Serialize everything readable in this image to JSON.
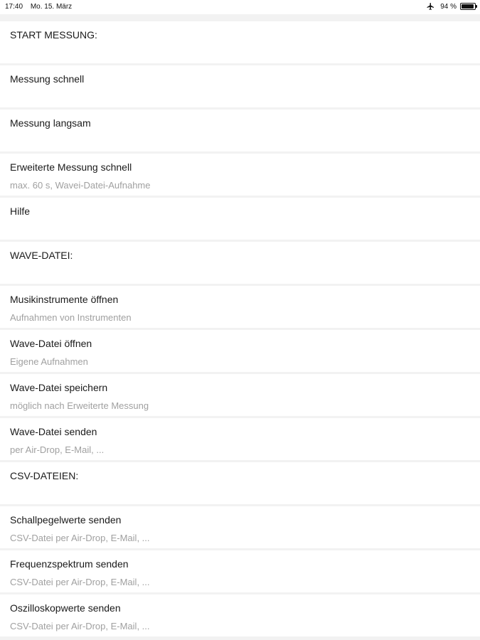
{
  "status_bar": {
    "time": "17:40",
    "date": "Mo. 15. März",
    "battery": "94 %",
    "battery_level": 0.94,
    "icons": [
      "airplane-icon",
      "battery-icon"
    ]
  },
  "rows": [
    {
      "title": "START MESSUNG:",
      "subtitle": ""
    },
    {
      "title": "Messung schnell",
      "subtitle": ""
    },
    {
      "title": "Messung langsam",
      "subtitle": ""
    },
    {
      "title": "Erweiterte Messung schnell",
      "subtitle": "max. 60 s, Wavei-Datei-Aufnahme"
    },
    {
      "title": "Hilfe",
      "subtitle": ""
    },
    {
      "title": "WAVE-DATEI:",
      "subtitle": ""
    },
    {
      "title": "Musikinstrumente öffnen",
      "subtitle": "Aufnahmen von Instrumenten"
    },
    {
      "title": "Wave-Datei öffnen",
      "subtitle": "Eigene Aufnahmen"
    },
    {
      "title": "Wave-Datei speichern",
      "subtitle": "möglich nach Erweiterte Messung"
    },
    {
      "title": "Wave-Datei senden",
      "subtitle": "per Air-Drop, E-Mail, ..."
    },
    {
      "title": "CSV-DATEIEN:",
      "subtitle": ""
    },
    {
      "title": "Schallpegelwerte senden",
      "subtitle": "CSV-Datei per Air-Drop, E-Mail, ..."
    },
    {
      "title": "Frequenzspektrum senden",
      "subtitle": "CSV-Datei per Air-Drop, E-Mail, ..."
    },
    {
      "title": "Oszilloskopwerte senden",
      "subtitle": "CSV-Datei per Air-Drop, E-Mail, ..."
    }
  ]
}
